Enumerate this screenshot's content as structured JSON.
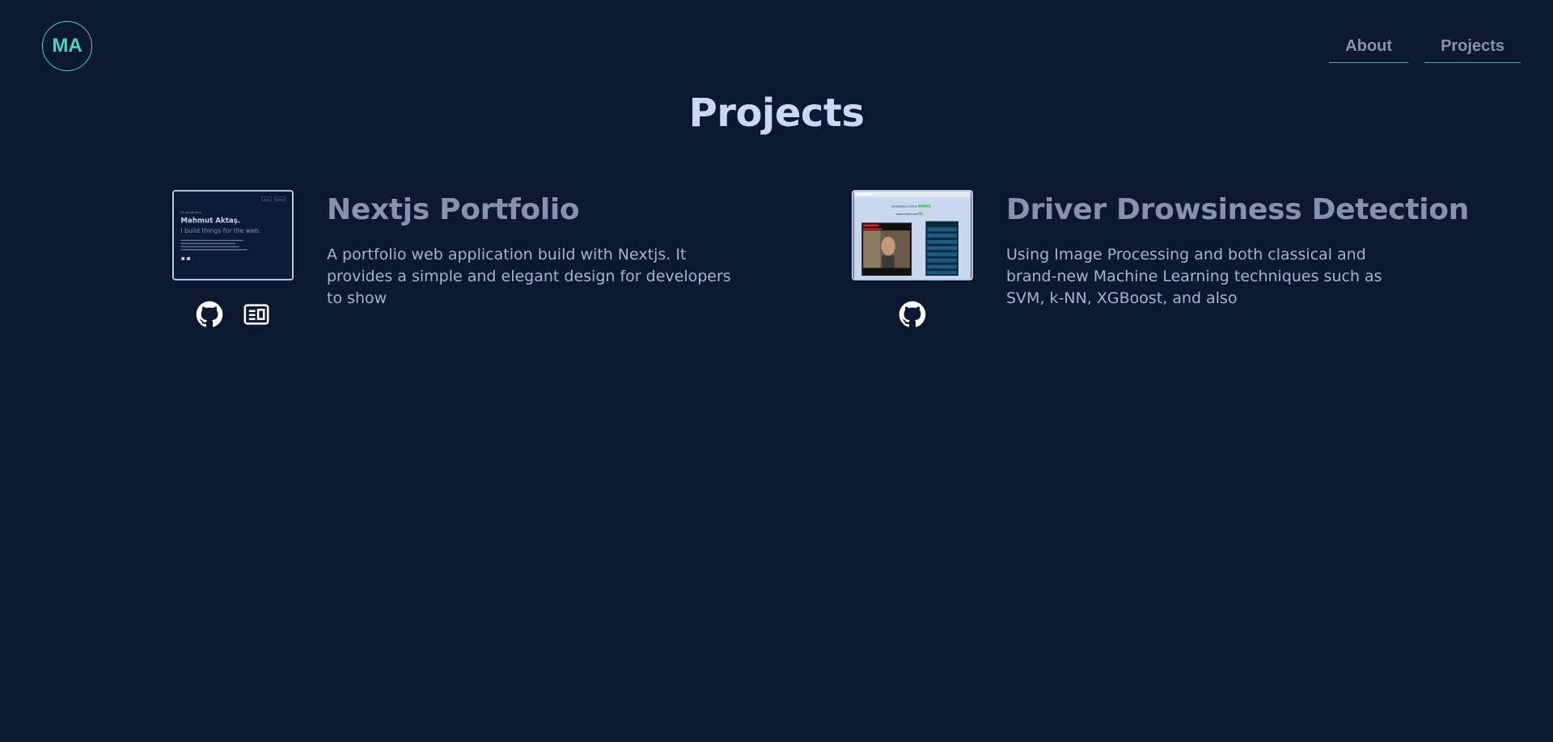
{
  "header": {
    "logo_text": "MA",
    "nav": [
      {
        "label": "About"
      },
      {
        "label": "Projects"
      }
    ]
  },
  "page": {
    "title": "Projects"
  },
  "projects": [
    {
      "title": "Nextjs Portfolio",
      "description": "A portfolio web application build with Nextjs. It provides a simple and elegant design for developers to show",
      "thumbnail": {
        "nav": [
          "About",
          "Projects"
        ],
        "intro": "Hi, my name is",
        "name": "Mahmut Aktaş.",
        "tagline": "I build things for the web."
      },
      "links": [
        {
          "icon": "github-icon"
        },
        {
          "icon": "article-icon"
        }
      ]
    },
    {
      "title": "Driver Drowsiness Detection",
      "description": "Using Image Processing and both classical and brand-new Machine Learning techniques such as SVM, k-NN, XGBoost, and also",
      "thumbnail": {
        "status_label": "DROWSINESS STATUS:",
        "status_value": "AWAKE",
        "sleep_label": "SLEEP DETECTION:",
        "sleep_value": "OK"
      },
      "links": [
        {
          "icon": "github-icon"
        }
      ]
    }
  ],
  "colors": {
    "background": "#0b1830",
    "accent": "#4fd1c5",
    "title": "#ccd6f6",
    "muted": "#8892b0"
  }
}
